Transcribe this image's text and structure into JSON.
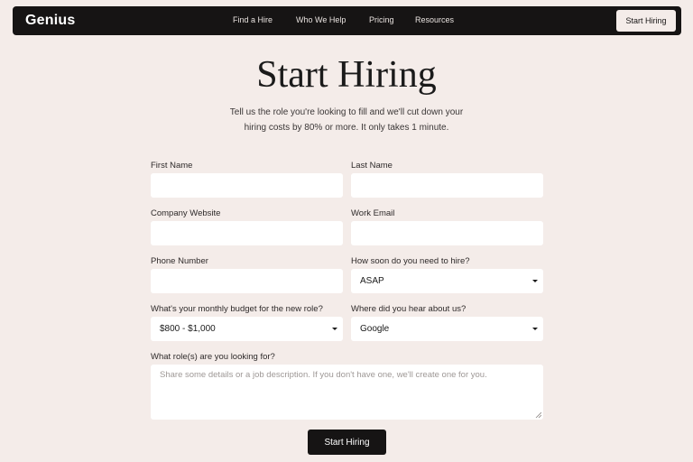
{
  "nav": {
    "logo": "Genius",
    "links": [
      "Find a Hire",
      "Who We Help",
      "Pricing",
      "Resources"
    ],
    "cta": "Start Hiring"
  },
  "hero": {
    "title": "Start Hiring",
    "subtitle_line1": "Tell us the role you're looking to fill and we'll cut down your",
    "subtitle_line2": "hiring costs by 80% or more. It only takes 1 minute."
  },
  "form": {
    "first_name_label": "First Name",
    "first_name_value": "",
    "last_name_label": "Last Name",
    "last_name_value": "",
    "company_website_label": "Company Website",
    "company_website_value": "",
    "work_email_label": "Work Email",
    "work_email_value": "",
    "phone_label": "Phone Number",
    "phone_value": "",
    "hire_timing_label": "How soon do you need to hire?",
    "hire_timing_value": "ASAP",
    "budget_label": "What's your monthly budget for the new role?",
    "budget_value": "$800 - $1,000",
    "referral_label": "Where did you hear about us?",
    "referral_value": "Google",
    "roles_label": "What role(s) are you looking for?",
    "roles_placeholder": "Share some details or a job description. If you don't have one, we'll create one for you.",
    "submit_label": "Start Hiring"
  },
  "colors": {
    "background": "#f4ece9",
    "dark": "#161414",
    "field": "#ffffff"
  }
}
